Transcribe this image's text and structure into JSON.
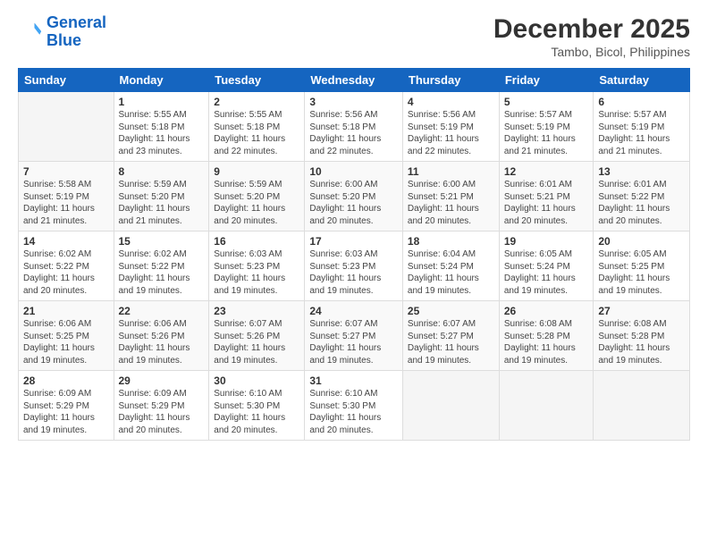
{
  "header": {
    "logo_line1": "General",
    "logo_line2": "Blue",
    "title": "December 2025",
    "subtitle": "Tambo, Bicol, Philippines"
  },
  "weekdays": [
    "Sunday",
    "Monday",
    "Tuesday",
    "Wednesday",
    "Thursday",
    "Friday",
    "Saturday"
  ],
  "weeks": [
    [
      {
        "day": "",
        "info": ""
      },
      {
        "day": "1",
        "info": "Sunrise: 5:55 AM\nSunset: 5:18 PM\nDaylight: 11 hours\nand 23 minutes."
      },
      {
        "day": "2",
        "info": "Sunrise: 5:55 AM\nSunset: 5:18 PM\nDaylight: 11 hours\nand 22 minutes."
      },
      {
        "day": "3",
        "info": "Sunrise: 5:56 AM\nSunset: 5:18 PM\nDaylight: 11 hours\nand 22 minutes."
      },
      {
        "day": "4",
        "info": "Sunrise: 5:56 AM\nSunset: 5:19 PM\nDaylight: 11 hours\nand 22 minutes."
      },
      {
        "day": "5",
        "info": "Sunrise: 5:57 AM\nSunset: 5:19 PM\nDaylight: 11 hours\nand 21 minutes."
      },
      {
        "day": "6",
        "info": "Sunrise: 5:57 AM\nSunset: 5:19 PM\nDaylight: 11 hours\nand 21 minutes."
      }
    ],
    [
      {
        "day": "7",
        "info": "Sunrise: 5:58 AM\nSunset: 5:19 PM\nDaylight: 11 hours\nand 21 minutes."
      },
      {
        "day": "8",
        "info": "Sunrise: 5:59 AM\nSunset: 5:20 PM\nDaylight: 11 hours\nand 21 minutes."
      },
      {
        "day": "9",
        "info": "Sunrise: 5:59 AM\nSunset: 5:20 PM\nDaylight: 11 hours\nand 20 minutes."
      },
      {
        "day": "10",
        "info": "Sunrise: 6:00 AM\nSunset: 5:20 PM\nDaylight: 11 hours\nand 20 minutes."
      },
      {
        "day": "11",
        "info": "Sunrise: 6:00 AM\nSunset: 5:21 PM\nDaylight: 11 hours\nand 20 minutes."
      },
      {
        "day": "12",
        "info": "Sunrise: 6:01 AM\nSunset: 5:21 PM\nDaylight: 11 hours\nand 20 minutes."
      },
      {
        "day": "13",
        "info": "Sunrise: 6:01 AM\nSunset: 5:22 PM\nDaylight: 11 hours\nand 20 minutes."
      }
    ],
    [
      {
        "day": "14",
        "info": "Sunrise: 6:02 AM\nSunset: 5:22 PM\nDaylight: 11 hours\nand 20 minutes."
      },
      {
        "day": "15",
        "info": "Sunrise: 6:02 AM\nSunset: 5:22 PM\nDaylight: 11 hours\nand 19 minutes."
      },
      {
        "day": "16",
        "info": "Sunrise: 6:03 AM\nSunset: 5:23 PM\nDaylight: 11 hours\nand 19 minutes."
      },
      {
        "day": "17",
        "info": "Sunrise: 6:03 AM\nSunset: 5:23 PM\nDaylight: 11 hours\nand 19 minutes."
      },
      {
        "day": "18",
        "info": "Sunrise: 6:04 AM\nSunset: 5:24 PM\nDaylight: 11 hours\nand 19 minutes."
      },
      {
        "day": "19",
        "info": "Sunrise: 6:05 AM\nSunset: 5:24 PM\nDaylight: 11 hours\nand 19 minutes."
      },
      {
        "day": "20",
        "info": "Sunrise: 6:05 AM\nSunset: 5:25 PM\nDaylight: 11 hours\nand 19 minutes."
      }
    ],
    [
      {
        "day": "21",
        "info": "Sunrise: 6:06 AM\nSunset: 5:25 PM\nDaylight: 11 hours\nand 19 minutes."
      },
      {
        "day": "22",
        "info": "Sunrise: 6:06 AM\nSunset: 5:26 PM\nDaylight: 11 hours\nand 19 minutes."
      },
      {
        "day": "23",
        "info": "Sunrise: 6:07 AM\nSunset: 5:26 PM\nDaylight: 11 hours\nand 19 minutes."
      },
      {
        "day": "24",
        "info": "Sunrise: 6:07 AM\nSunset: 5:27 PM\nDaylight: 11 hours\nand 19 minutes."
      },
      {
        "day": "25",
        "info": "Sunrise: 6:07 AM\nSunset: 5:27 PM\nDaylight: 11 hours\nand 19 minutes."
      },
      {
        "day": "26",
        "info": "Sunrise: 6:08 AM\nSunset: 5:28 PM\nDaylight: 11 hours\nand 19 minutes."
      },
      {
        "day": "27",
        "info": "Sunrise: 6:08 AM\nSunset: 5:28 PM\nDaylight: 11 hours\nand 19 minutes."
      }
    ],
    [
      {
        "day": "28",
        "info": "Sunrise: 6:09 AM\nSunset: 5:29 PM\nDaylight: 11 hours\nand 19 minutes."
      },
      {
        "day": "29",
        "info": "Sunrise: 6:09 AM\nSunset: 5:29 PM\nDaylight: 11 hours\nand 20 minutes."
      },
      {
        "day": "30",
        "info": "Sunrise: 6:10 AM\nSunset: 5:30 PM\nDaylight: 11 hours\nand 20 minutes."
      },
      {
        "day": "31",
        "info": "Sunrise: 6:10 AM\nSunset: 5:30 PM\nDaylight: 11 hours\nand 20 minutes."
      },
      {
        "day": "",
        "info": ""
      },
      {
        "day": "",
        "info": ""
      },
      {
        "day": "",
        "info": ""
      }
    ]
  ]
}
